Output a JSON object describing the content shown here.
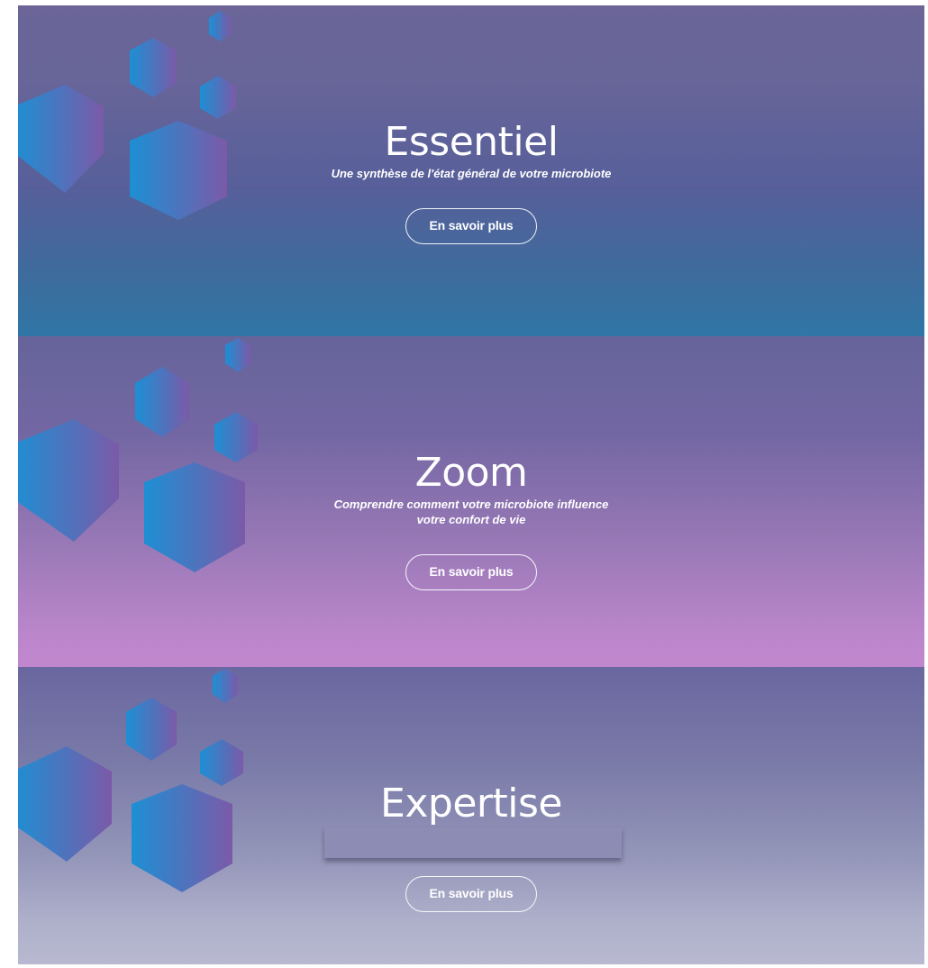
{
  "panels": [
    {
      "title": "Essentiel",
      "subtitle": "Une synthèse de l'état général de votre microbiote",
      "button_label": "En savoir plus"
    },
    {
      "title": "Zoom",
      "subtitle": "Comprendre comment votre microbiote influence votre confort de vie",
      "button_label": "En savoir plus"
    },
    {
      "title": "Expertise",
      "subtitle": "",
      "button_label": "En savoir plus"
    }
  ],
  "colors": {
    "hex_start": "#1d8fd4",
    "hex_end": "#7b5aa8",
    "button_border": "#ffffff",
    "text": "#ffffff"
  }
}
